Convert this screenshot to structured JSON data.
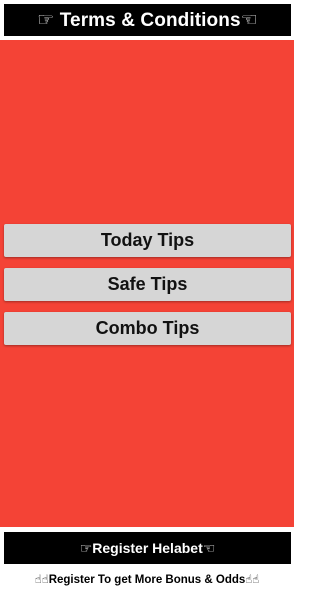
{
  "header": {
    "terms_label": "☞ Terms & Conditions☜"
  },
  "tips": {
    "today_label": "Today Tips",
    "safe_label": "Safe Tips",
    "combo_label": "Combo Tips"
  },
  "footer": {
    "register_label": "☞Register Helabet☜",
    "promo_text": "☝☝Register To get More Bonus & Odds☝☝"
  },
  "colors": {
    "panel_red": "#f44336",
    "bar_black": "#000000",
    "button_gray": "#d6d6d6"
  }
}
